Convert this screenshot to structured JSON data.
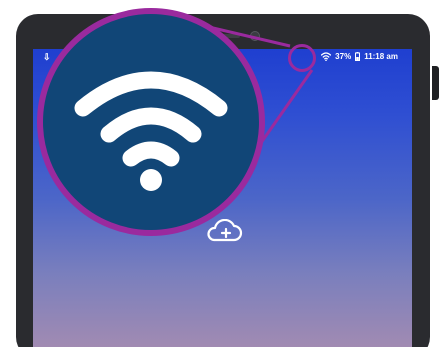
{
  "status_bar": {
    "left_icon": "notification-icon",
    "wifi_icon": "wifi-icon",
    "battery_percent": "37%",
    "battery_icon": "battery-icon",
    "time": "11:18 am"
  },
  "home_screen": {
    "center_icon": "cloud-add-icon"
  },
  "callout": {
    "icon": "wifi-icon",
    "accent_color": "#9a2a9e",
    "background_color": "#114677"
  },
  "device": {
    "frame_color": "#2a2b2f",
    "screen_top_color": "#1f3fd0",
    "screen_bottom_color": "#a28bb2"
  }
}
